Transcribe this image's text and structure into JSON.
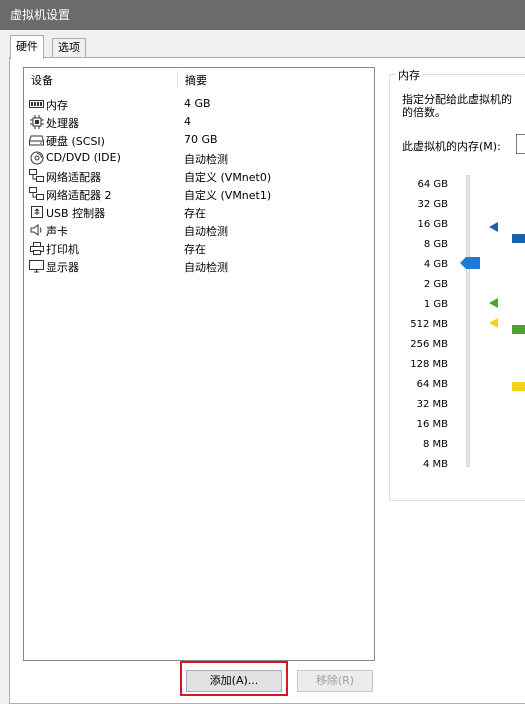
{
  "window": {
    "title": "虚拟机设置"
  },
  "tabs": [
    {
      "label": "硬件",
      "active": true
    },
    {
      "label": "选项",
      "active": false
    }
  ],
  "device_list": {
    "headers": {
      "device": "设备",
      "summary": "摘要"
    },
    "rows": [
      {
        "icon": "memory-icon",
        "name": "内存",
        "summary": "4 GB",
        "selected": true
      },
      {
        "icon": "processor-icon",
        "name": "处理器",
        "summary": "4"
      },
      {
        "icon": "hard-disk-icon",
        "name": "硬盘 (SCSI)",
        "summary": "70 GB"
      },
      {
        "icon": "cd-dvd-icon",
        "name": "CD/DVD (IDE)",
        "summary": "自动检测"
      },
      {
        "icon": "network-adapter-icon",
        "name": "网络适配器",
        "summary": "自定义 (VMnet0)"
      },
      {
        "icon": "network-adapter-icon",
        "name": "网络适配器 2",
        "summary": "自定义 (VMnet1)"
      },
      {
        "icon": "usb-icon",
        "name": "USB 控制器",
        "summary": "存在"
      },
      {
        "icon": "sound-icon",
        "name": "声卡",
        "summary": "自动检测"
      },
      {
        "icon": "printer-icon",
        "name": "打印机",
        "summary": "存在"
      },
      {
        "icon": "display-icon",
        "name": "显示器",
        "summary": "自动检测"
      }
    ]
  },
  "buttons": {
    "add": "添加(A)...",
    "remove": "移除(R)"
  },
  "memory_panel": {
    "group_title": "内存",
    "description_line1": "指定分配给此虚拟机的",
    "description_line2": "的倍数。",
    "memory_label": "此虚拟机的内存(M):",
    "current_value": "4 GB",
    "scale_ticks": [
      "64 GB",
      "32 GB",
      "16 GB",
      "8 GB",
      "4 GB",
      "2 GB",
      "1 GB",
      "512 MB",
      "256 MB",
      "128 MB",
      "64 MB",
      "32 MB",
      "16 MB",
      "8 MB",
      "4 MB"
    ],
    "markers": [
      {
        "color": "#1e5fa8",
        "at": "16 GB"
      },
      {
        "color": "#4aa52e",
        "at": "1 GB"
      },
      {
        "color": "#f2d31b",
        "at": "512 MB"
      }
    ]
  },
  "colors": {
    "titlebar": "#6b6b6b",
    "thumb": "#1f7ad6",
    "highlight": "#d01a22"
  }
}
